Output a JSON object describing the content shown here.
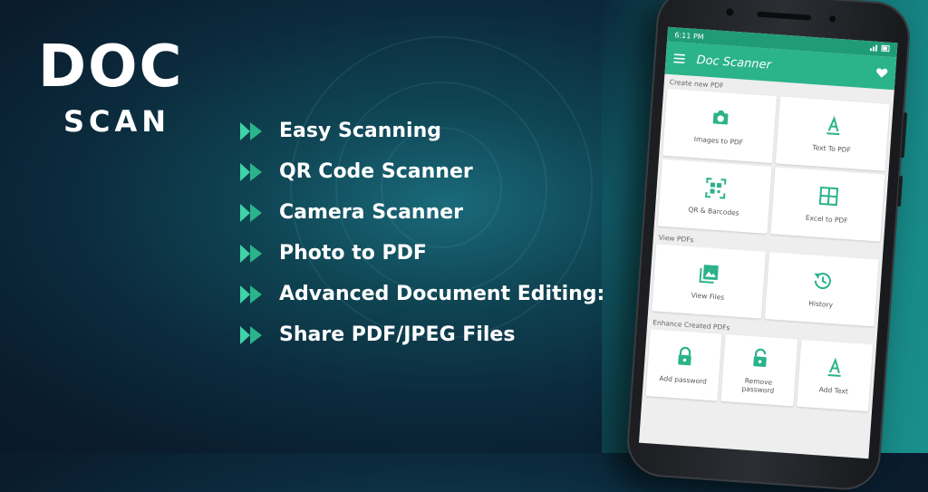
{
  "brand": {
    "line1": "DOC",
    "line2": "SCAN"
  },
  "features": [
    "Easy Scanning",
    "QR Code Scanner",
    "Camera Scanner",
    "Photo to PDF",
    "Advanced Document Editing:",
    "Share PDF/JPEG Files"
  ],
  "phone": {
    "status_time": "6:11 PM",
    "app_title": "Doc Scanner",
    "sections": {
      "create": "Create new PDF",
      "view": "View PDFs",
      "enhance": "Enhance Created PDFs"
    },
    "create_items": [
      {
        "label": "Images to PDF",
        "icon": "camera-icon"
      },
      {
        "label": "Text To PDF",
        "icon": "text-icon"
      },
      {
        "label": "QR & Barcodes",
        "icon": "qr-icon"
      },
      {
        "label": "Excel to PDF",
        "icon": "grid-icon"
      }
    ],
    "view_items": [
      {
        "label": "View Files",
        "icon": "gallery-icon"
      },
      {
        "label": "History",
        "icon": "history-icon"
      }
    ],
    "enhance_items": [
      {
        "label": "Add password",
        "icon": "lock-icon"
      },
      {
        "label": "Remove password",
        "icon": "unlock-icon"
      },
      {
        "label": "Add Text",
        "icon": "text-icon"
      }
    ]
  },
  "colors": {
    "accent": "#2bb38a",
    "accent_dark": "#1f9c76",
    "bullet": "#3fd3a6",
    "text": "#ffffff"
  }
}
